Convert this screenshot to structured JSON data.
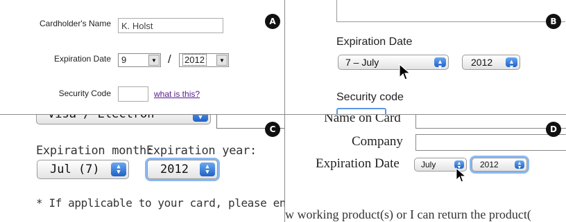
{
  "panel_a": {
    "badge": "A",
    "cardholder_label": "Cardholder's Name",
    "cardholder_value": "K. Holst",
    "expiration_label": "Expiration Date",
    "month_value": "9",
    "separator": "/",
    "year_value": "2012",
    "security_label": "Security Code",
    "security_value": "",
    "what_link": "what is this?"
  },
  "panel_b": {
    "badge": "B",
    "expiration_label": "Expiration Date",
    "month_value": "7 – July",
    "year_value": "2012",
    "security_label": "Security code"
  },
  "panel_c": {
    "badge": "C",
    "card_type_value": "Visa / Electron",
    "month_label": "Expiration month:",
    "year_label": "Expiration year:",
    "month_value": "Jul (7)",
    "year_value": "2012",
    "note": "* If applicable to your card, please enter"
  },
  "panel_d": {
    "badge": "D",
    "name_label": "Name on Card",
    "company_label": "Company",
    "expiration_label": "Expiration Date",
    "month_value": "July",
    "year_value": "2012",
    "footer_text": "w working product(s) or I can return the product("
  },
  "icons": {
    "arrow_down": "▼",
    "arrow_up": "▲"
  }
}
